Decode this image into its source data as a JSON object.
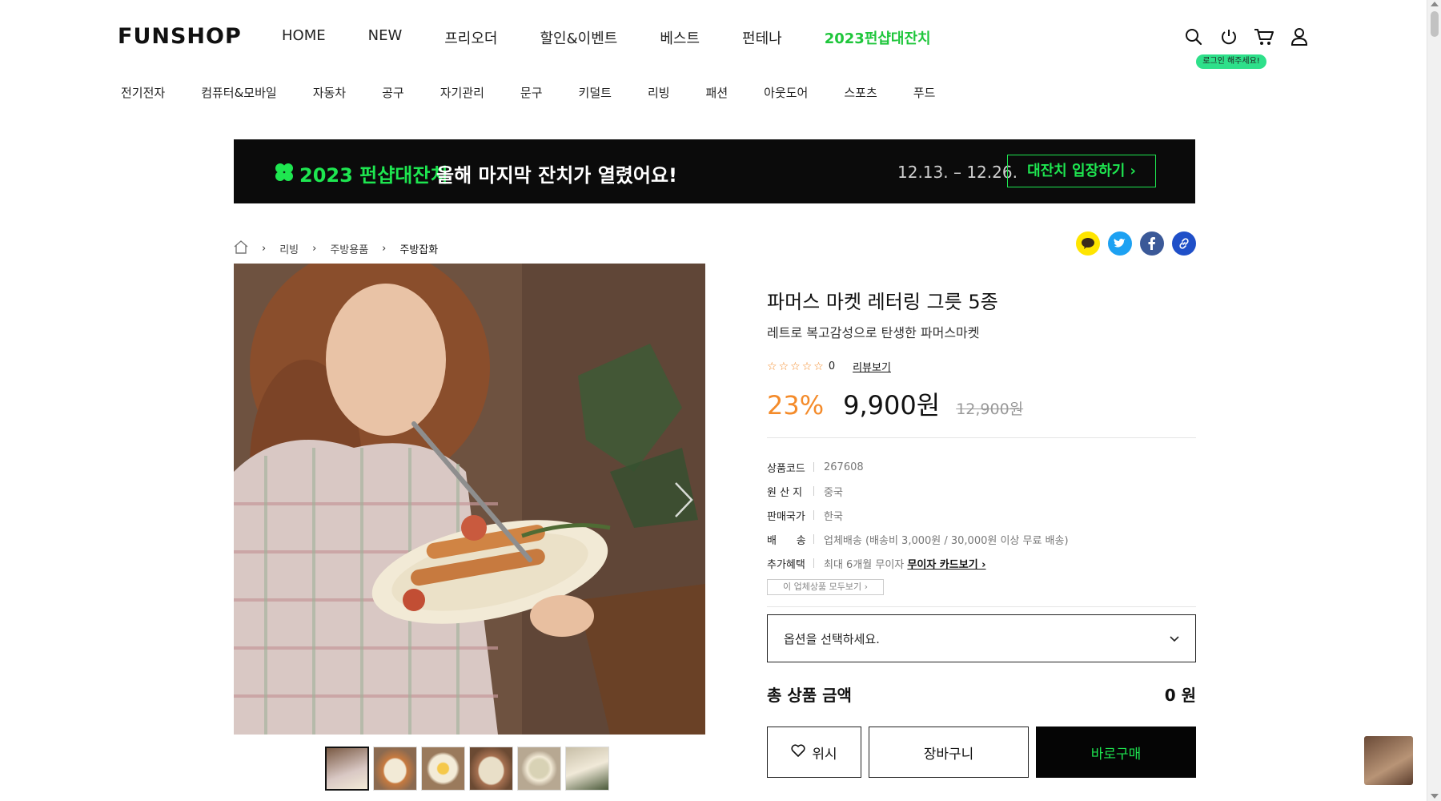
{
  "header": {
    "logo": "FUNSHOP",
    "gnb": [
      "HOME",
      "NEW",
      "프리오더",
      "할인&이벤트",
      "베스트",
      "펀테나",
      "2023펀샵대잔치"
    ],
    "gnb_highlight_index": 6,
    "login_badge": "로그인 해주세요!",
    "icons": [
      "search-icon",
      "power-icon",
      "cart-icon",
      "user-icon"
    ]
  },
  "categories": [
    "전기전자",
    "컴퓨터&모바일",
    "자동차",
    "공구",
    "자기관리",
    "문구",
    "키덜트",
    "리빙",
    "패션",
    "아웃도어",
    "스포츠",
    "푸드"
  ],
  "banner": {
    "title": "2023 펀샵대잔치",
    "subtitle": "올해 마지막 잔치가 열렸어요!",
    "dates": "12.13. – 12.26.",
    "cta": "대잔치 입장하기 ›"
  },
  "breadcrumb": [
    "리빙",
    "주방용품",
    "주방잡화"
  ],
  "share_icons": [
    "kakao-icon",
    "twitter-icon",
    "facebook-icon",
    "link-icon"
  ],
  "product": {
    "name": "파머스 마켓 레터링 그릇 5종",
    "description": "레트로 복고감성으로 탄생한 파머스마켓",
    "rating_count": "0",
    "review_link": "리뷰보기",
    "discount": "23%",
    "price": "9,900원",
    "original_price": "12,900원",
    "specs": [
      {
        "key": "상품코드",
        "value": "267608"
      },
      {
        "key": "원 산 지",
        "value": "중국"
      },
      {
        "key": "판매국가",
        "value": "한국"
      },
      {
        "key": "배      송",
        "value": "업체배송 (배송비 3,000원 / 30,000원 이상 무료 배송)"
      },
      {
        "key": "추가혜택",
        "value": "최대 6개월 무이자",
        "link": "무이자 카드보기 ›"
      }
    ],
    "seller_button": "이 업체상품 모두보기 ›",
    "option_placeholder": "옵션을 선택하세요.",
    "total_label": "총 상품 금액",
    "total_value": "0 원",
    "wish_label": "위시",
    "cart_label": "장바구니",
    "buy_label": "바로구매"
  },
  "colors": {
    "accent_green": "#1ee650",
    "discount_orange": "#f48b2a",
    "banner_bg": "#0b0b0b"
  }
}
